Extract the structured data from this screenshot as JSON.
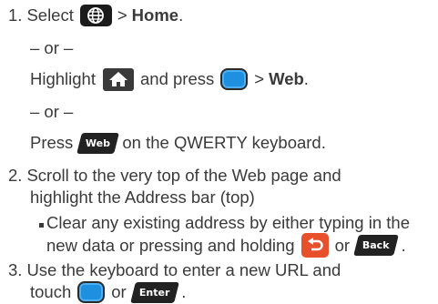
{
  "steps": {
    "s1": {
      "number": "1.",
      "select": "Select",
      "sep": ">",
      "home": "Home",
      "period": ".",
      "or1": "– or –",
      "highlight": "Highlight",
      "and_press": "and press",
      "sep2": ">",
      "web": "Web",
      "period2": ".",
      "or2": "– or –",
      "press": "Press",
      "web_key": "Web",
      "on_keyboard": "on the QWERTY keyboard."
    },
    "s2": {
      "number": "2.",
      "line1": "Scroll to the very top of the Web page and",
      "line2": "highlight the Address bar (top)",
      "bullet_line1": "Clear any existing address by either typing in the",
      "bullet_line2": "new data or pressing and holding",
      "or": "or",
      "back_key": "Back",
      "period": "."
    },
    "s3": {
      "number": "3.",
      "line1": "Use the keyboard to enter a new URL and",
      "touch": "touch",
      "or": "or",
      "enter_key": "Enter",
      "period": "."
    }
  },
  "icons": {
    "globe": "globe-icon",
    "home": "home-icon",
    "nav_key": "navigation-key-icon",
    "back_arrow": "back-arrow-icon"
  },
  "colors": {
    "text": "#3a3a3a",
    "nav_key_blue": "#1f8fe0",
    "back_key_orange": "#e8502c",
    "dark_key": "#222222"
  }
}
